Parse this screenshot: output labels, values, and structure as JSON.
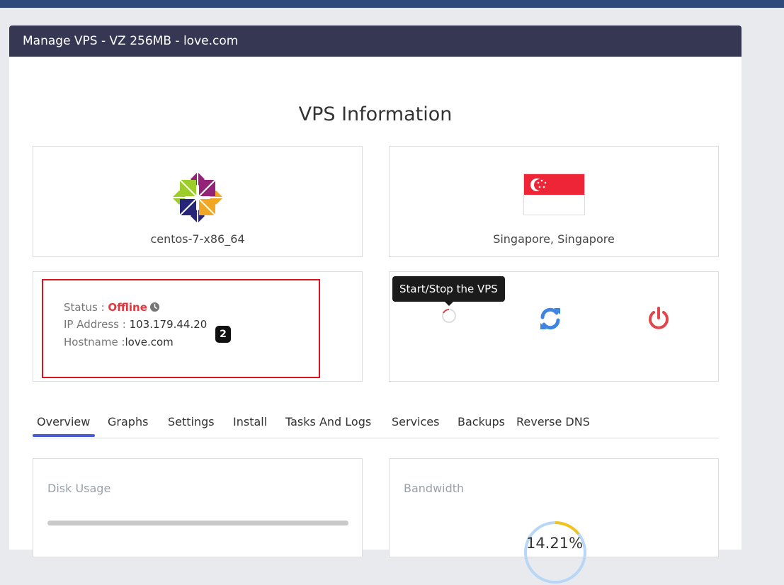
{
  "header": {
    "title": "Manage VPS - VZ 256MB - love.com"
  },
  "section_title": "VPS Information",
  "os": {
    "label": "centos-7-x86_64",
    "icon": "centos-logo-icon"
  },
  "location": {
    "label": "Singapore, Singapore",
    "icon": "singapore-flag-icon"
  },
  "info": {
    "status_label": "Status : ",
    "status_value": "Offline",
    "ip_label": "IP Address : ",
    "ip_value": "103.179.44.20",
    "hostname_label": "Hostname :",
    "hostname_value": "love.com",
    "badge": "2"
  },
  "actions": {
    "tooltip": "Start/Stop the VPS",
    "icons": [
      "loading-spinner-icon",
      "refresh-icon",
      "power-icon"
    ]
  },
  "tabs": [
    {
      "label": "Overview",
      "active": true
    },
    {
      "label": "Graphs"
    },
    {
      "label": "Settings"
    },
    {
      "label": "Install"
    },
    {
      "label": "Tasks And Logs"
    },
    {
      "label": "Services"
    },
    {
      "label": "Backups"
    },
    {
      "label": "Reverse DNS"
    }
  ],
  "disk": {
    "title": "Disk Usage",
    "usage_fraction": 0
  },
  "bandwidth": {
    "title": "Bandwidth",
    "percent_label": "14.21%",
    "percent": 14.21
  },
  "colors": {
    "topbar": "#2e4b7c",
    "header": "#363853",
    "offline": "#e0383e",
    "refresh": "#3f84e0",
    "power": "#e0464a",
    "tab_active": "#4a5bd8",
    "highlight_border": "#e0121c",
    "gauge_used": "#f0c419",
    "gauge_track": "#b8d6f6"
  }
}
